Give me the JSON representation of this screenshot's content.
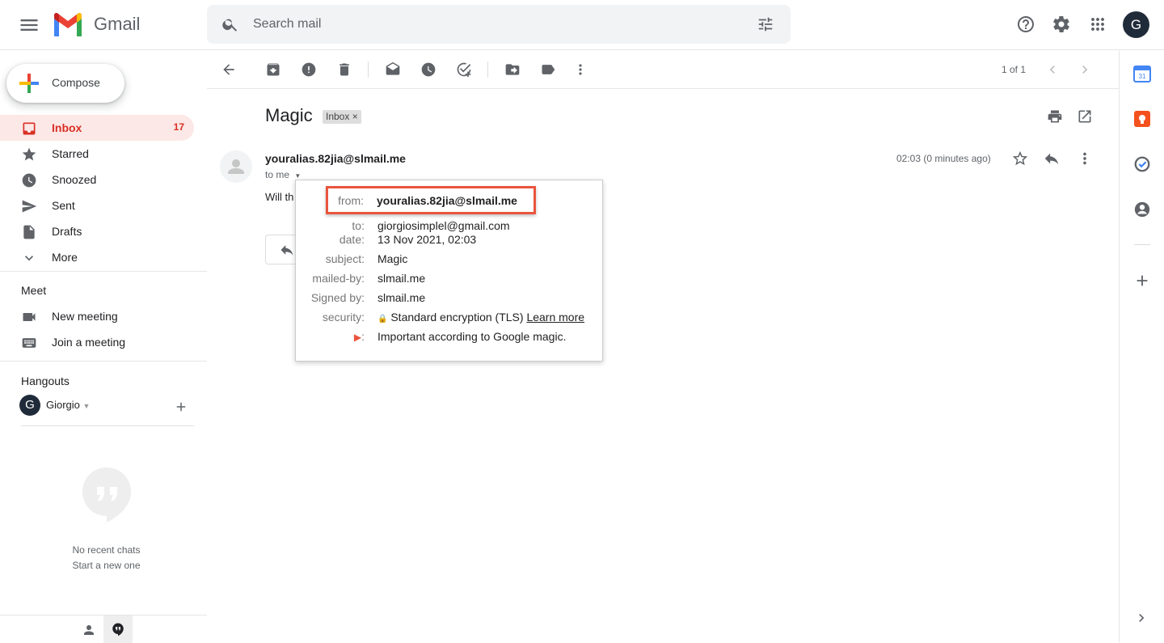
{
  "header": {
    "app_name": "Gmail",
    "search_placeholder": "Search mail",
    "avatar_letter": "G"
  },
  "sidebar": {
    "compose_label": "Compose",
    "items": [
      {
        "label": "Inbox",
        "count": "17",
        "icon": "inbox-icon"
      },
      {
        "label": "Starred",
        "icon": "star-icon"
      },
      {
        "label": "Snoozed",
        "icon": "clock-icon"
      },
      {
        "label": "Sent",
        "icon": "send-icon"
      },
      {
        "label": "Drafts",
        "icon": "draft-icon"
      },
      {
        "label": "More",
        "icon": "chevron-down-icon"
      }
    ],
    "meet": {
      "title": "Meet",
      "new_meeting": "New meeting",
      "join_meeting": "Join a meeting"
    },
    "hangouts": {
      "title": "Hangouts",
      "user_letter": "G",
      "user_name": "Giorgio",
      "no_recent": "No recent chats",
      "start_new": "Start a new one"
    }
  },
  "toolbar": {
    "pager": "1 of 1"
  },
  "message": {
    "subject": "Magic",
    "label_chip": "Inbox ×",
    "sender": "youralias.82jia@slmail.me",
    "to": "to me",
    "time": "02:03 (0 minutes ago)",
    "body_preview": "Will th"
  },
  "details": {
    "from_key": "from:",
    "from_val": "youralias.82jia@slmail.me",
    "to_key": "to:",
    "to_val": "giorgiosimplel@gmail.com",
    "date_key": "date:",
    "date_val": "13 Nov 2021, 02:03",
    "subject_key": "subject:",
    "subject_val": "Magic",
    "mailedby_key": "mailed-by:",
    "mailedby_val": "slmail.me",
    "signedby_key": "Signed by:",
    "signedby_val": "slmail.me",
    "security_key": "security:",
    "security_val": "Standard encryption (TLS)",
    "learn_more": "Learn more",
    "importance_key": ":",
    "importance_val": "Important according to Google magic."
  },
  "colors": {
    "accent_red": "#d93025",
    "highlight_border": "#e9553d",
    "active_nav_bg": "#fce8e6"
  }
}
